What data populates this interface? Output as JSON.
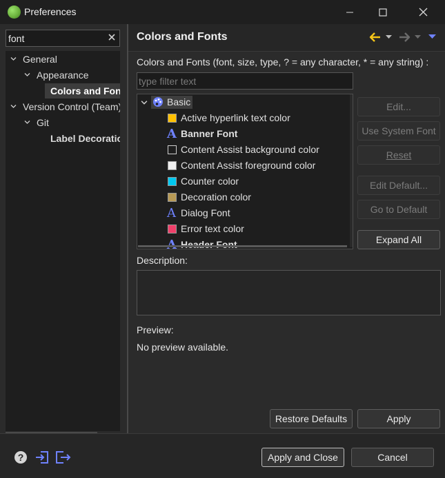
{
  "window": {
    "title": "Preferences",
    "controls": {
      "minimize": "minimize-icon",
      "maximize": "maximize-icon",
      "close": "close-icon"
    }
  },
  "left": {
    "filter_value": "font",
    "tree": [
      {
        "label": "General",
        "expanded": true
      },
      {
        "label": "Appearance",
        "expanded": true
      },
      {
        "label": "Colors and Fonts",
        "selected": true
      },
      {
        "label": "Version Control (Team)",
        "expanded": true
      },
      {
        "label": "Git",
        "expanded": true
      },
      {
        "label": "Label Decorations"
      }
    ]
  },
  "page": {
    "title": "Colors and Fonts",
    "nav_icons": [
      "back-arrow-icon",
      "back-menu-icon",
      "forward-arrow-icon",
      "forward-menu-icon",
      "view-menu-icon"
    ],
    "filter_label": "Colors and Fonts (font, size, type, ? = any character, * = any string) :",
    "filter_placeholder": "type filter text",
    "category": "Basic",
    "items": [
      {
        "label": "Active hyperlink text color",
        "kind": "color",
        "color": "#ffc000"
      },
      {
        "label": "Banner Font",
        "kind": "font",
        "bold": true
      },
      {
        "label": "Content Assist background color",
        "kind": "color",
        "color": "#1e1e1e"
      },
      {
        "label": "Content Assist foreground color",
        "kind": "color",
        "color": "#eeeeee"
      },
      {
        "label": "Counter color",
        "kind": "color",
        "color": "#00c8f0"
      },
      {
        "label": "Decoration color",
        "kind": "color",
        "color": "#b89a55"
      },
      {
        "label": "Dialog Font",
        "kind": "font"
      },
      {
        "label": "Error text color",
        "kind": "color",
        "color": "#f0406a"
      },
      {
        "label": "Header Font",
        "kind": "font",
        "bold": true
      }
    ],
    "buttons": {
      "edit": "Edit...",
      "use_system_font": "Use System Font",
      "reset": "Reset",
      "edit_default": "Edit Default...",
      "go_to_default": "Go to Default",
      "expand_all": "Expand All"
    },
    "description_label": "Description:",
    "preview_label": "Preview:",
    "preview_text": "No preview available.",
    "restore_defaults": "Restore Defaults",
    "apply": "Apply"
  },
  "footer": {
    "icons": [
      "help-icon",
      "import-icon",
      "export-icon"
    ],
    "apply_and_close": "Apply and Close",
    "cancel": "Cancel"
  },
  "colors": {
    "accent": "#6f82ff",
    "nav_arrow": "#f5c518"
  }
}
